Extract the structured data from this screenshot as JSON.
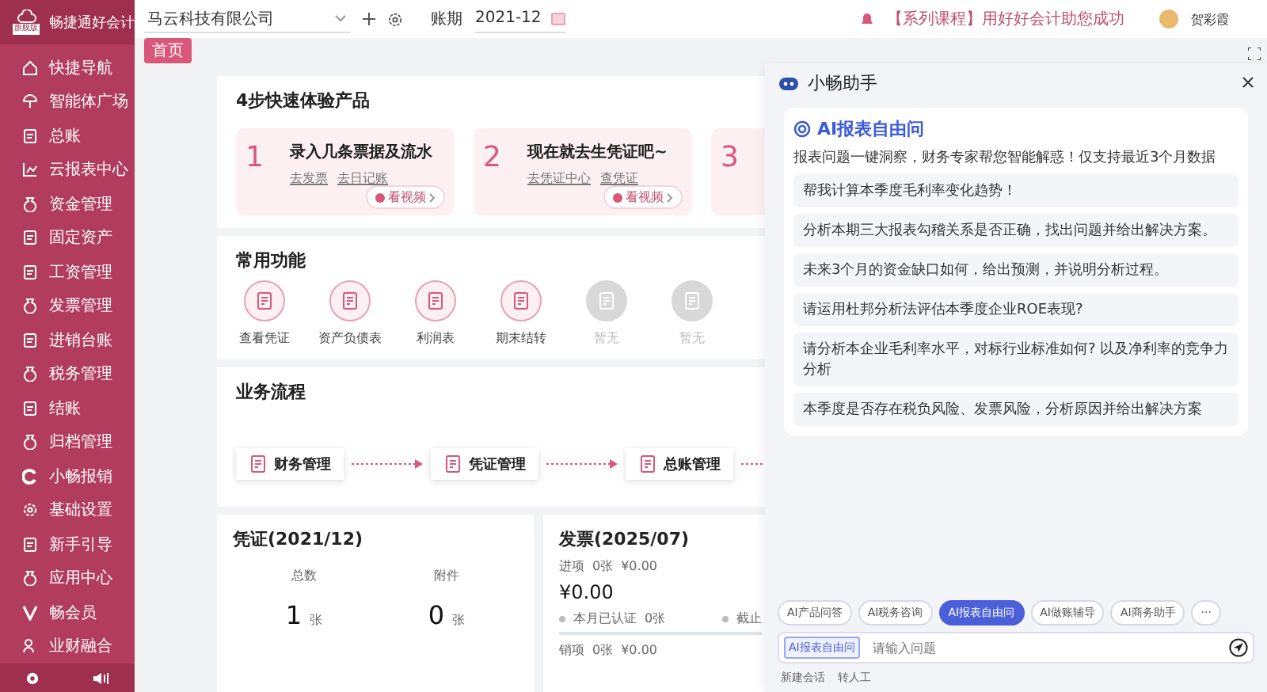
{
  "sidebar": {
    "brand": "畅捷通好会计",
    "edition": "旗舰版",
    "items": [
      {
        "label": "快捷导航"
      },
      {
        "label": "智能体广场"
      },
      {
        "label": "总账"
      },
      {
        "label": "云报表中心"
      },
      {
        "label": "资金管理"
      },
      {
        "label": "固定资产"
      },
      {
        "label": "工资管理"
      },
      {
        "label": "发票管理"
      },
      {
        "label": "进销台账"
      },
      {
        "label": "税务管理"
      },
      {
        "label": "结账"
      },
      {
        "label": "归档管理"
      },
      {
        "label": "小畅报销"
      },
      {
        "label": "基础设置"
      },
      {
        "label": "新手引导"
      },
      {
        "label": "应用中心"
      },
      {
        "label": "畅会员"
      },
      {
        "label": "业财融合"
      }
    ]
  },
  "topbar": {
    "company": "马云科技有限公司",
    "period_label": "账期",
    "period": "2021-12",
    "notice": "【系列课程】用好好会计助您成功",
    "user": "贺彩霞"
  },
  "tabs": [
    {
      "label": "首页",
      "selected": true
    }
  ],
  "steps": {
    "title": "4步快速体验产品",
    "items": [
      {
        "number": "1",
        "title": "录入几条票据及流水",
        "links": [
          "去发票",
          "去日记账"
        ],
        "video": "看视频"
      },
      {
        "number": "2",
        "title": "现在就去生凭证吧~",
        "links": [
          "去凭证中心",
          "查凭证"
        ],
        "video": "看视频"
      },
      {
        "number": "3"
      }
    ]
  },
  "functions": {
    "title": "常用功能",
    "items": [
      {
        "label": "查看凭证",
        "disabled": false
      },
      {
        "label": "资产负债表",
        "disabled": false
      },
      {
        "label": "利润表",
        "disabled": false
      },
      {
        "label": "期末结转",
        "disabled": false
      },
      {
        "label": "暂无",
        "disabled": true
      },
      {
        "label": "暂无",
        "disabled": true
      }
    ]
  },
  "flow": {
    "title": "业务流程",
    "items": [
      {
        "label": "财务管理"
      },
      {
        "label": "凭证管理"
      },
      {
        "label": "总账管理"
      }
    ]
  },
  "voucher": {
    "title": "凭证(2021/12)",
    "stats": [
      {
        "label": "总数",
        "value": "1",
        "unit": "张"
      },
      {
        "label": "附件",
        "value": "0",
        "unit": "张"
      }
    ]
  },
  "invoice": {
    "title": "发票(2025/07)",
    "input_label": "进项",
    "input_count": "0张",
    "input_amount": "¥0.00",
    "total": "¥0.00",
    "certified": "本月已认证",
    "certified_count": "0张",
    "deadline": "截止",
    "output_label": "销项",
    "output_count": "0张",
    "output_amount": "¥0.00"
  },
  "assistant": {
    "title": "小畅助手",
    "card_title": "AI报表自由问",
    "intro": "报表问题一键洞察，财务专家帮您智能解惑！仅支持最近3个月数据",
    "questions": [
      "帮我计算本季度毛利率变化趋势！",
      "分析本期三大报表勾稽关系是否正确，找出问题并给出解决方案。",
      "未来3个月的资金缺口如何，给出预测，并说明分析过程。",
      "请运用杜邦分析法评估本季度企业ROE表现?",
      "请分析本企业毛利率水平，对标行业标准如何? 以及净利率的竞争力分析",
      "本季度是否存在税负风险、发票风险，分析原因并给出解决方案"
    ],
    "chips": [
      {
        "label": "AI产品问答",
        "selected": false
      },
      {
        "label": "AI税务咨询",
        "selected": false
      },
      {
        "label": "AI报表自由问",
        "selected": true
      },
      {
        "label": "AI做账辅导",
        "selected": false
      },
      {
        "label": "AI商务助手",
        "selected": false
      },
      {
        "label": "···",
        "selected": false
      }
    ],
    "input_tag": "AI报表自由问",
    "placeholder": "请输入问题",
    "footer_links": [
      "新建会话",
      "转人工"
    ]
  }
}
